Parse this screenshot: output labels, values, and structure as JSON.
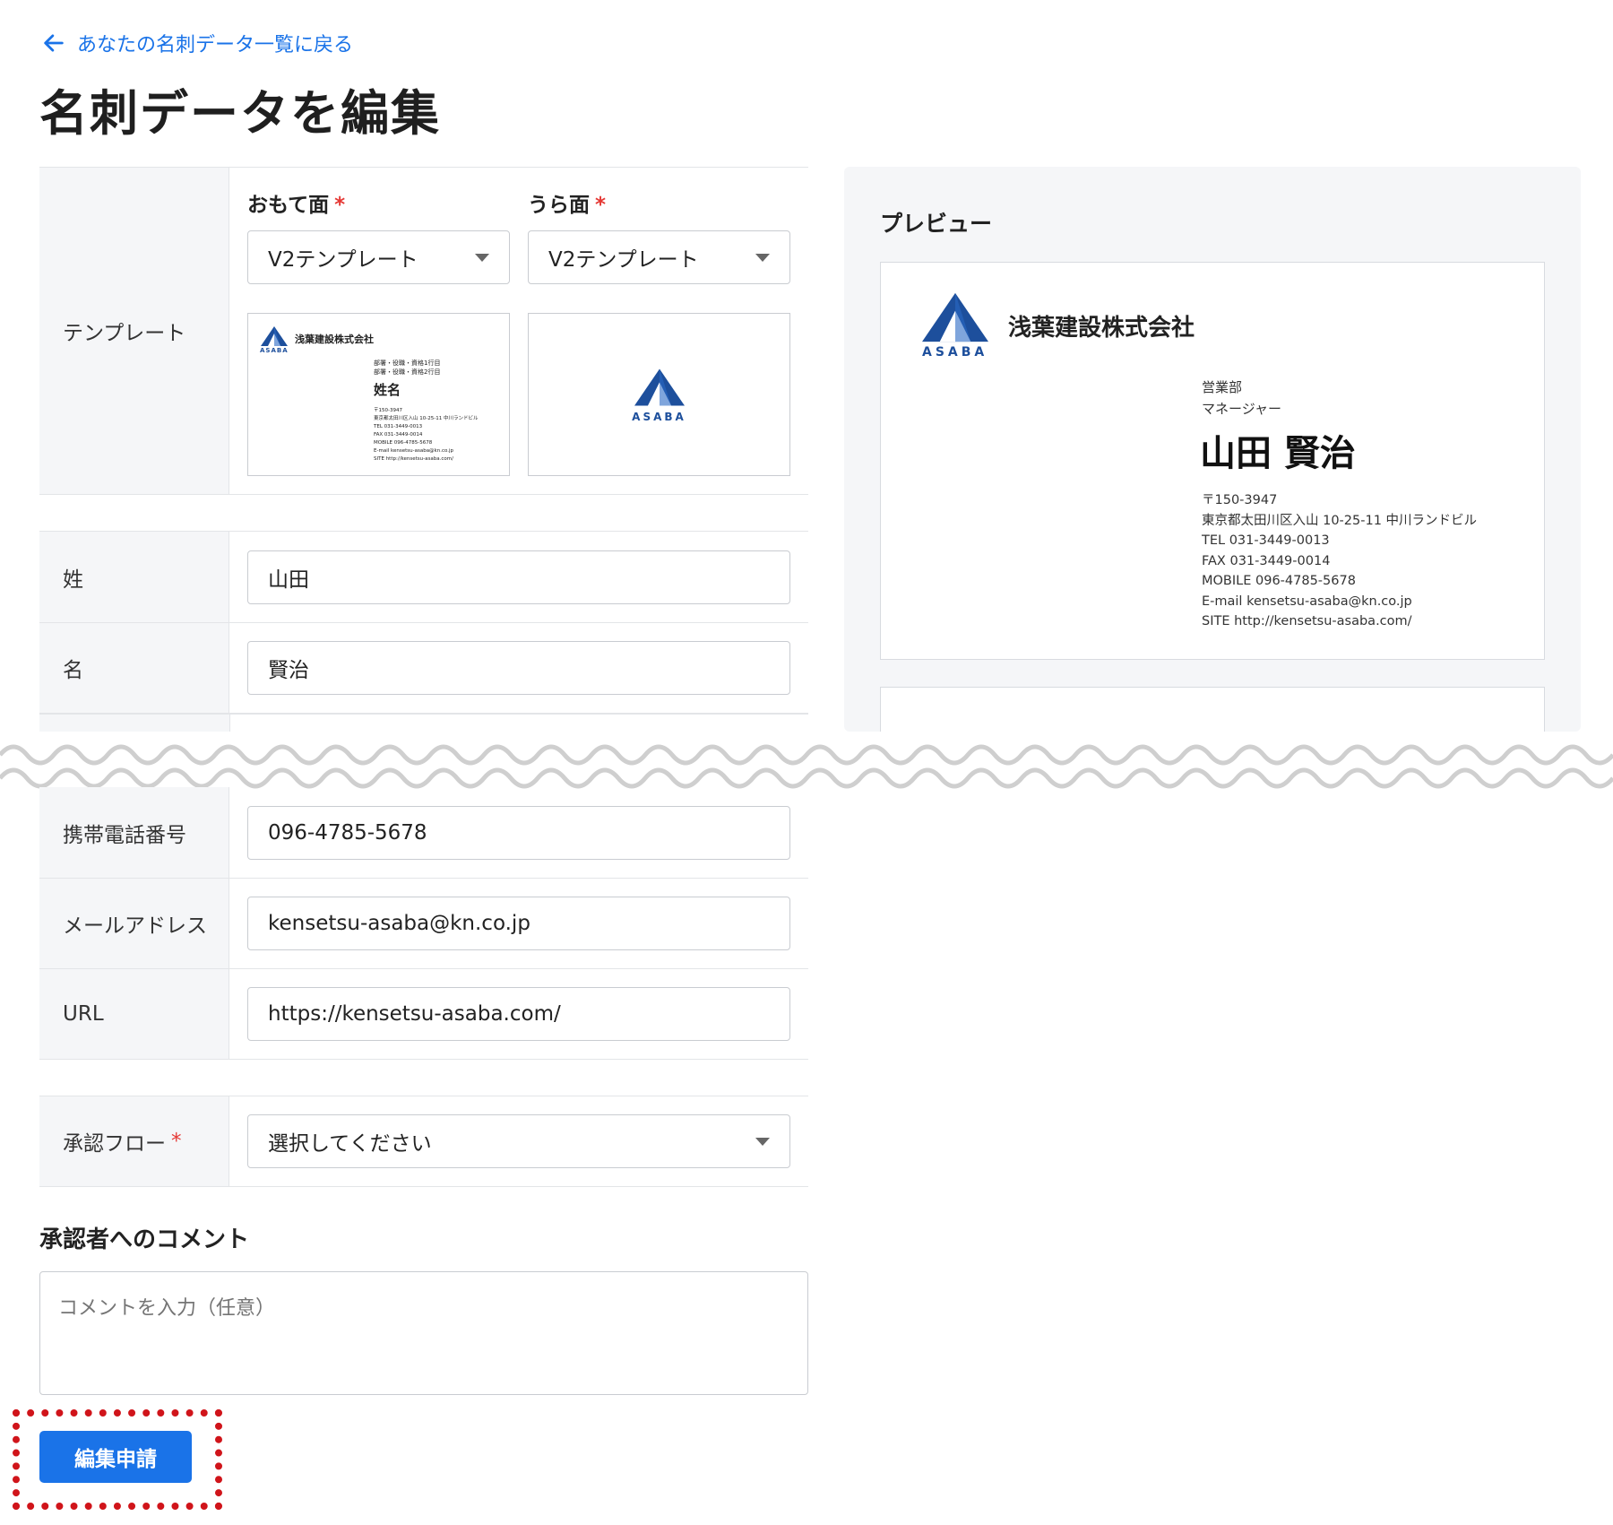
{
  "nav": {
    "back_label": "あなたの名刺データ一覧に戻る"
  },
  "page": {
    "title": "名刺データを編集"
  },
  "template": {
    "label": "テンプレート",
    "front": {
      "label": "おもて面",
      "required_mark": "*",
      "selected": "V2テンプレート"
    },
    "back": {
      "label": "うら面",
      "required_mark": "*",
      "selected": "V2テンプレート"
    },
    "thumb_front": {
      "company": "浅葉建設株式会社",
      "logo_text": "ASABA",
      "dept_line1": "部署・役職・資格1行目",
      "dept_line2": "部署・役職・資格2行目",
      "name": "姓名",
      "details": [
        "〒150-3947",
        "東京都太田川区入山 10-25-11 中川ランドビル",
        "TEL 031-3449-0013",
        "FAX 031-3449-0014",
        "MOBILE 096-4785-5678",
        "E-mail kensetsu-asaba@kn.co.jp",
        "SITE http://kensetsu-asaba.com/"
      ]
    },
    "thumb_back": {
      "logo_text": "ASABA"
    }
  },
  "fields": {
    "last_name": {
      "label": "姓",
      "value": "山田"
    },
    "first_name": {
      "label": "名",
      "value": "賢治"
    },
    "mobile": {
      "label": "携帯電話番号",
      "value": "096-4785-5678"
    },
    "email": {
      "label": "メールアドレス",
      "value": "kensetsu-asaba@kn.co.jp"
    },
    "url": {
      "label": "URL",
      "value": "https://kensetsu-asaba.com/"
    },
    "approval": {
      "label": "承認フロー",
      "required_mark": "*",
      "selected": "選択してください"
    }
  },
  "preview": {
    "title": "プレビュー",
    "company": "浅葉建設株式会社",
    "logo_text": "ASABA",
    "dept": "営業部",
    "role": "マネージャー",
    "name": "山田 賢治",
    "details": [
      "〒150-3947",
      "東京都太田川区入山 10-25-11 中川ランドビル",
      "TEL 031-3449-0013",
      "FAX 031-3449-0014",
      "MOBILE 096-4785-5678",
      "E-mail kensetsu-asaba@kn.co.jp",
      "SITE http://kensetsu-asaba.com/"
    ]
  },
  "comment": {
    "label": "承認者へのコメント",
    "placeholder": "コメントを入力（任意）"
  },
  "actions": {
    "submit_label": "編集申請"
  },
  "colors": {
    "accent": "#1a73e8",
    "logo": "#1d4f9c",
    "required": "#e53935",
    "highlight": "#d0141a"
  }
}
